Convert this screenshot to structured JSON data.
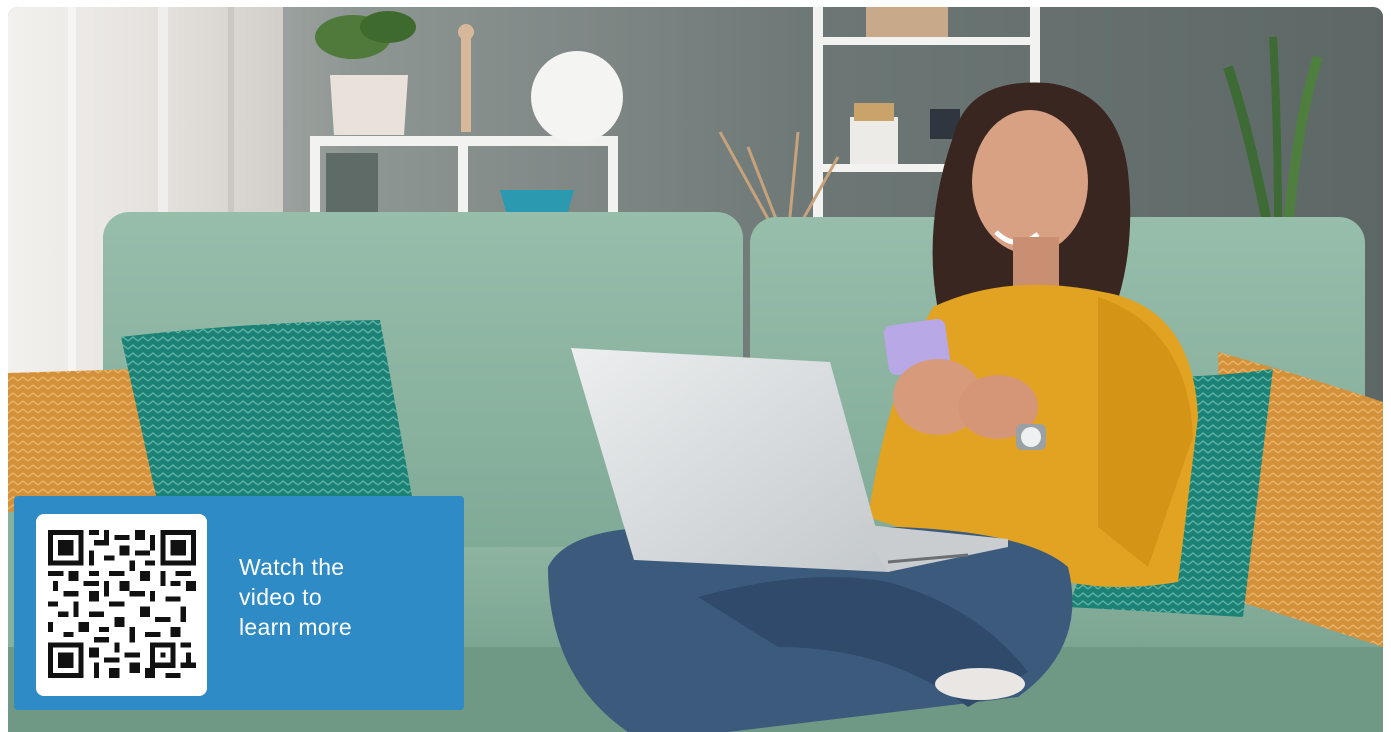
{
  "promo": {
    "cta_lines": [
      "Watch the",
      "video to",
      "learn more"
    ],
    "qr_icon": "qr-code-icon"
  },
  "colors": {
    "card_background": "#2e8bc6",
    "sofa": "#8cb5a2",
    "sweater": "#e1a321",
    "wall": "#6f7a78"
  }
}
